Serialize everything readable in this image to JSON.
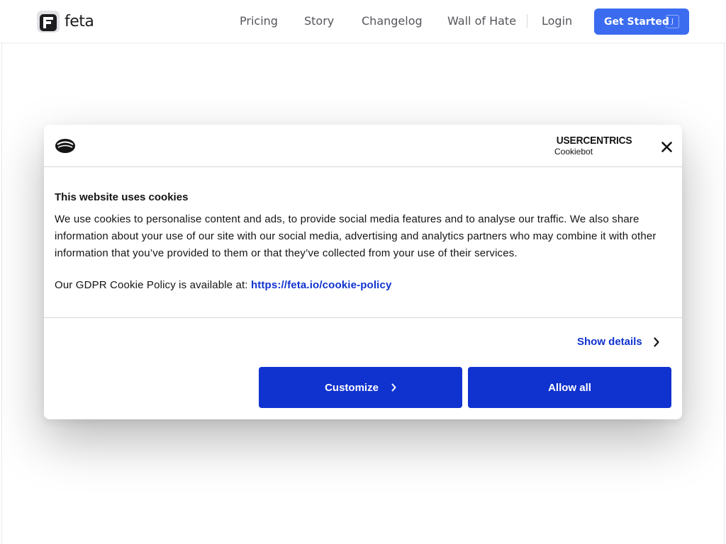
{
  "header": {
    "logo_text": "feta",
    "nav": [
      "Pricing",
      "Story",
      "Changelog",
      "Wall of Hate",
      "Login"
    ],
    "cta_label": "Get Started",
    "cta_shortcut": "J",
    "accent_color": "#3b6cf0"
  },
  "cookie_dialog": {
    "brand_line1": "USERCENTRICS",
    "brand_line2": "Cookiebot",
    "title": "This website uses cookies",
    "description": "We use cookies to personalise content and ads, to provide social media features and to analyse our traffic. We also share information about your use of our site with our social media, advertising and analytics partners who may combine it with other information that you’ve provided to them or that they’ve collected from your use of their services.",
    "policy_prefix": "Our GDPR Cookie Policy is available at: ",
    "policy_link": "https://feta.io/cookie-policy",
    "show_details_label": "Show details",
    "customize_label": "Customize",
    "allow_all_label": "Allow all",
    "button_color": "#1032cf"
  }
}
